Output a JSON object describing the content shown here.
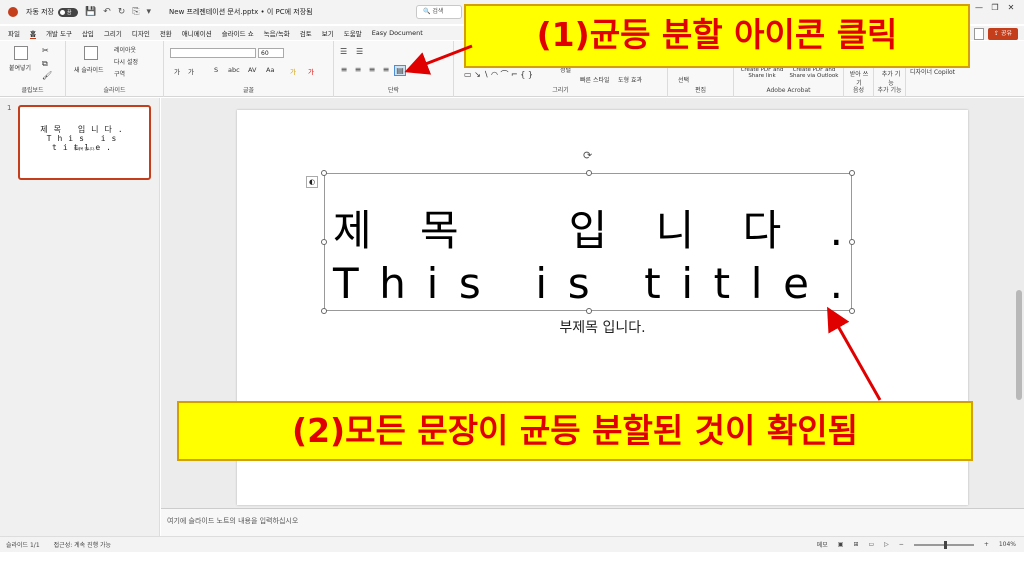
{
  "titlebar": {
    "autosave": "자동 저장",
    "toggle": "끔",
    "filename": "New 프레젠테이션 문서.pptx • 이 PC에 저장됨",
    "search": "검색",
    "window_controls": [
      "—",
      "❐",
      "✕"
    ]
  },
  "menu": {
    "items": [
      "파일",
      "홈",
      "개발 도구",
      "삽입",
      "그리기",
      "디자인",
      "전환",
      "애니메이션",
      "슬라이드 쇼",
      "녹음/녹화",
      "검토",
      "보기",
      "도움말",
      "Easy Document"
    ],
    "share": "공유"
  },
  "ribbon": {
    "clipboard": {
      "paste": "붙여넣기",
      "label": "클립보드"
    },
    "slides": {
      "new_slide": "새 슬라이드",
      "layout": "레이아웃",
      "reset": "다시 설정",
      "section": "구역",
      "label": "슬라이드"
    },
    "font": {
      "size": "60",
      "tools": [
        "가",
        "가",
        "S",
        "abc",
        "AV",
        "Aa",
        "가",
        "가"
      ],
      "label": "글꼴"
    },
    "paragraph": {
      "label": "단락"
    },
    "drawing": {
      "arrange": "정렬",
      "quick_styles": "빠른 스타일",
      "shape_effects": "도형 효과",
      "label": "그리기"
    },
    "editing": {
      "select": "선택",
      "label": "편집"
    },
    "acrobat": {
      "create_share": "Create PDF and Share link",
      "create_outlook": "Create PDF and Share via Outlook",
      "label": "Adobe Acrobat"
    },
    "voice": {
      "dictate": "받아 쓰기",
      "label": "음성"
    },
    "addins": {
      "addins": "추가 기능",
      "label": "추가 기능"
    },
    "designer": {
      "copilot": "디자이너 Copilot"
    }
  },
  "slides_panel": {
    "slide_number": "1",
    "thumb_title": "제목 입니다.",
    "thumb_title_en": "This is title.",
    "thumb_subtitle": "부제목 입니다."
  },
  "slide": {
    "title_line1": [
      "제",
      "목",
      "",
      "입",
      "니",
      "다",
      "."
    ],
    "title_line2": [
      "T",
      "h",
      "i",
      "s",
      "",
      "i",
      "s",
      "",
      "t",
      "i",
      "t",
      "l",
      "e",
      "."
    ],
    "subtitle": "부제목 입니다."
  },
  "notes": {
    "placeholder": "여기에 슬라이드 노트의 내용을 입력하십시오"
  },
  "statusbar": {
    "slide_info": "슬라이드 1/1",
    "accessibility": "접근성: 계속 진행 가능",
    "notes": "메모",
    "zoom": "104%"
  },
  "annotations": {
    "step1": "(1)균등 분할 아이콘 클릭",
    "step2": "(2)모든 문장이 균등 분할된 것이 확인됨"
  },
  "colors": {
    "accent": "#c43e1c",
    "annotation_bg": "#ffff00",
    "annotation_text": "#e00000"
  }
}
